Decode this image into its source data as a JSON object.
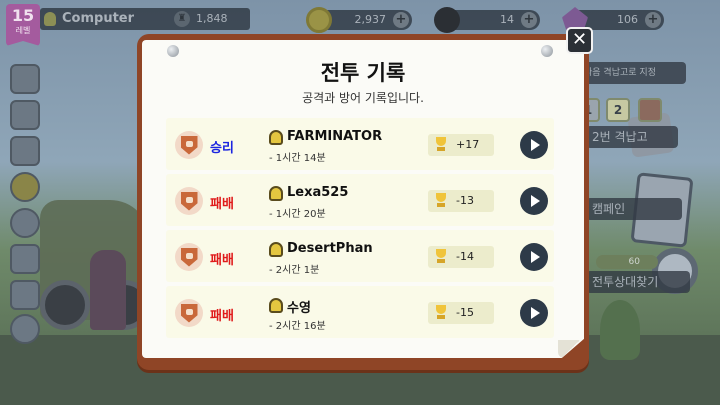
{
  "hud": {
    "level": "15",
    "level_caption": "레벨",
    "player_name": "Computer",
    "trophies": "1,848",
    "coins": "2,937",
    "bombs": "14",
    "gems": "106",
    "coin_plus": "+",
    "bomb_plus": "+",
    "gem_plus": "+"
  },
  "side": {
    "nav_label": "다음 격납고로 지정",
    "slots": [
      "1",
      "2",
      ""
    ],
    "scout_label": "2번 격납고",
    "campaign_label": "캠페인",
    "cost": "60",
    "opponent_label": "전투상대찾기"
  },
  "modal": {
    "title": "전투 기록",
    "subtitle": "공격과 방어 기록입니다.",
    "close_label": "✕",
    "rows": [
      {
        "result": "승리",
        "outcome": "win",
        "opponent": "FARMINATOR",
        "time": "- 1시간 14분",
        "trophy_delta": "+17"
      },
      {
        "result": "패배",
        "outcome": "loss",
        "opponent": "Lexa525",
        "time": "- 1시간 20분",
        "trophy_delta": "-13"
      },
      {
        "result": "패배",
        "outcome": "loss",
        "opponent": "DesertPhan",
        "time": "- 2시간 1분",
        "trophy_delta": "-14"
      },
      {
        "result": "패배",
        "outcome": "loss",
        "opponent": "수영",
        "time": "- 2시간 16분",
        "trophy_delta": "-15"
      }
    ]
  },
  "colors": {
    "win": "#1b25e0",
    "loss": "#e01b1b",
    "frame": "#8f4526",
    "play_button": "#2d3a48"
  }
}
